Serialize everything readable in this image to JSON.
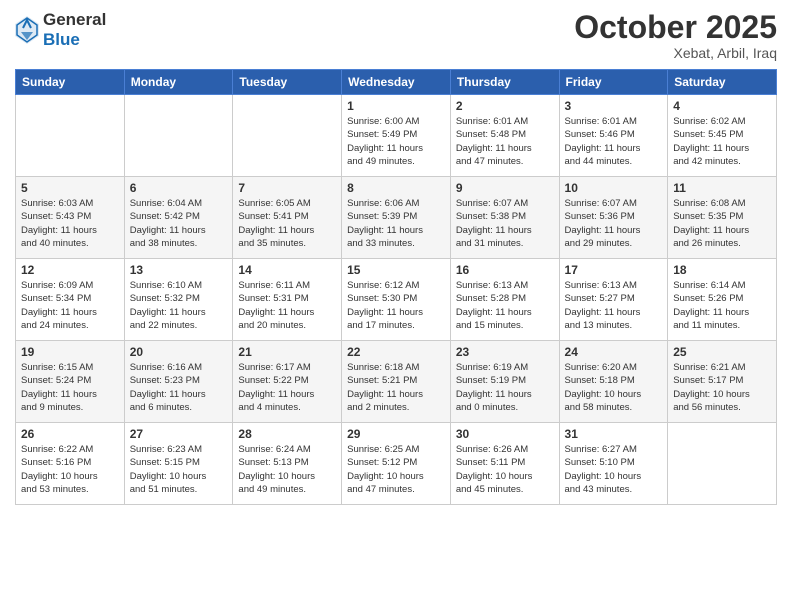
{
  "header": {
    "logo_line1": "General",
    "logo_line2": "Blue",
    "month": "October 2025",
    "location": "Xebat, Arbil, Iraq"
  },
  "weekdays": [
    "Sunday",
    "Monday",
    "Tuesday",
    "Wednesday",
    "Thursday",
    "Friday",
    "Saturday"
  ],
  "weeks": [
    [
      {
        "day": "",
        "info": ""
      },
      {
        "day": "",
        "info": ""
      },
      {
        "day": "",
        "info": ""
      },
      {
        "day": "1",
        "info": "Sunrise: 6:00 AM\nSunset: 5:49 PM\nDaylight: 11 hours\nand 49 minutes."
      },
      {
        "day": "2",
        "info": "Sunrise: 6:01 AM\nSunset: 5:48 PM\nDaylight: 11 hours\nand 47 minutes."
      },
      {
        "day": "3",
        "info": "Sunrise: 6:01 AM\nSunset: 5:46 PM\nDaylight: 11 hours\nand 44 minutes."
      },
      {
        "day": "4",
        "info": "Sunrise: 6:02 AM\nSunset: 5:45 PM\nDaylight: 11 hours\nand 42 minutes."
      }
    ],
    [
      {
        "day": "5",
        "info": "Sunrise: 6:03 AM\nSunset: 5:43 PM\nDaylight: 11 hours\nand 40 minutes."
      },
      {
        "day": "6",
        "info": "Sunrise: 6:04 AM\nSunset: 5:42 PM\nDaylight: 11 hours\nand 38 minutes."
      },
      {
        "day": "7",
        "info": "Sunrise: 6:05 AM\nSunset: 5:41 PM\nDaylight: 11 hours\nand 35 minutes."
      },
      {
        "day": "8",
        "info": "Sunrise: 6:06 AM\nSunset: 5:39 PM\nDaylight: 11 hours\nand 33 minutes."
      },
      {
        "day": "9",
        "info": "Sunrise: 6:07 AM\nSunset: 5:38 PM\nDaylight: 11 hours\nand 31 minutes."
      },
      {
        "day": "10",
        "info": "Sunrise: 6:07 AM\nSunset: 5:36 PM\nDaylight: 11 hours\nand 29 minutes."
      },
      {
        "day": "11",
        "info": "Sunrise: 6:08 AM\nSunset: 5:35 PM\nDaylight: 11 hours\nand 26 minutes."
      }
    ],
    [
      {
        "day": "12",
        "info": "Sunrise: 6:09 AM\nSunset: 5:34 PM\nDaylight: 11 hours\nand 24 minutes."
      },
      {
        "day": "13",
        "info": "Sunrise: 6:10 AM\nSunset: 5:32 PM\nDaylight: 11 hours\nand 22 minutes."
      },
      {
        "day": "14",
        "info": "Sunrise: 6:11 AM\nSunset: 5:31 PM\nDaylight: 11 hours\nand 20 minutes."
      },
      {
        "day": "15",
        "info": "Sunrise: 6:12 AM\nSunset: 5:30 PM\nDaylight: 11 hours\nand 17 minutes."
      },
      {
        "day": "16",
        "info": "Sunrise: 6:13 AM\nSunset: 5:28 PM\nDaylight: 11 hours\nand 15 minutes."
      },
      {
        "day": "17",
        "info": "Sunrise: 6:13 AM\nSunset: 5:27 PM\nDaylight: 11 hours\nand 13 minutes."
      },
      {
        "day": "18",
        "info": "Sunrise: 6:14 AM\nSunset: 5:26 PM\nDaylight: 11 hours\nand 11 minutes."
      }
    ],
    [
      {
        "day": "19",
        "info": "Sunrise: 6:15 AM\nSunset: 5:24 PM\nDaylight: 11 hours\nand 9 minutes."
      },
      {
        "day": "20",
        "info": "Sunrise: 6:16 AM\nSunset: 5:23 PM\nDaylight: 11 hours\nand 6 minutes."
      },
      {
        "day": "21",
        "info": "Sunrise: 6:17 AM\nSunset: 5:22 PM\nDaylight: 11 hours\nand 4 minutes."
      },
      {
        "day": "22",
        "info": "Sunrise: 6:18 AM\nSunset: 5:21 PM\nDaylight: 11 hours\nand 2 minutes."
      },
      {
        "day": "23",
        "info": "Sunrise: 6:19 AM\nSunset: 5:19 PM\nDaylight: 11 hours\nand 0 minutes."
      },
      {
        "day": "24",
        "info": "Sunrise: 6:20 AM\nSunset: 5:18 PM\nDaylight: 10 hours\nand 58 minutes."
      },
      {
        "day": "25",
        "info": "Sunrise: 6:21 AM\nSunset: 5:17 PM\nDaylight: 10 hours\nand 56 minutes."
      }
    ],
    [
      {
        "day": "26",
        "info": "Sunrise: 6:22 AM\nSunset: 5:16 PM\nDaylight: 10 hours\nand 53 minutes."
      },
      {
        "day": "27",
        "info": "Sunrise: 6:23 AM\nSunset: 5:15 PM\nDaylight: 10 hours\nand 51 minutes."
      },
      {
        "day": "28",
        "info": "Sunrise: 6:24 AM\nSunset: 5:13 PM\nDaylight: 10 hours\nand 49 minutes."
      },
      {
        "day": "29",
        "info": "Sunrise: 6:25 AM\nSunset: 5:12 PM\nDaylight: 10 hours\nand 47 minutes."
      },
      {
        "day": "30",
        "info": "Sunrise: 6:26 AM\nSunset: 5:11 PM\nDaylight: 10 hours\nand 45 minutes."
      },
      {
        "day": "31",
        "info": "Sunrise: 6:27 AM\nSunset: 5:10 PM\nDaylight: 10 hours\nand 43 minutes."
      },
      {
        "day": "",
        "info": ""
      }
    ]
  ]
}
